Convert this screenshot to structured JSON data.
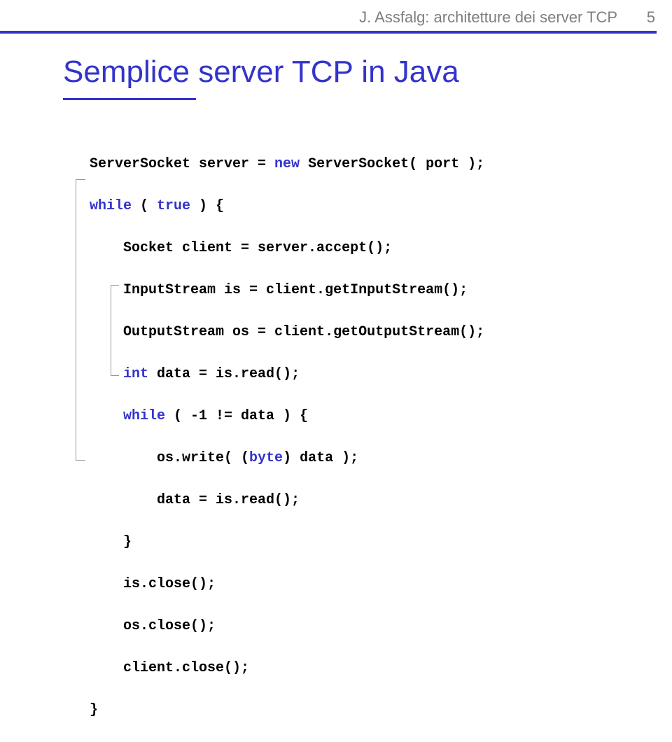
{
  "header": {
    "text": "J. Assfalg: architetture dei server TCP",
    "page": "5"
  },
  "title": "Semplice server TCP in Java",
  "code": [
    {
      "pre": "",
      "plain": "ServerSocket server = ",
      "kw": "new",
      "tail": " ServerSocket( port );"
    },
    {
      "pre": "",
      "kw": "while",
      "plain": " ( ",
      "kw2": "true",
      "tail": " ) {"
    },
    {
      "pre": "    ",
      "plain": "Socket client = server.accept();"
    },
    {
      "pre": "    ",
      "plain": "InputStream is = client.getInputStream();"
    },
    {
      "pre": "    ",
      "plain": "OutputStream os = client.getOutputStream();"
    },
    {
      "pre": "    ",
      "kw": "int",
      "plain": " data = is.read();"
    },
    {
      "pre": "    ",
      "kw": "while",
      "plain": " ( -1 != data ) {"
    },
    {
      "pre": "        ",
      "plain": "os.write( (",
      "kw": "byte",
      "tail": ") data );"
    },
    {
      "pre": "        ",
      "plain": "data = is.read();"
    },
    {
      "pre": "    ",
      "plain": "}"
    },
    {
      "pre": "    ",
      "plain": "is.close();"
    },
    {
      "pre": "    ",
      "plain": "os.close();"
    },
    {
      "pre": "    ",
      "plain": "client.close();"
    },
    {
      "pre": "",
      "plain": "}"
    }
  ]
}
